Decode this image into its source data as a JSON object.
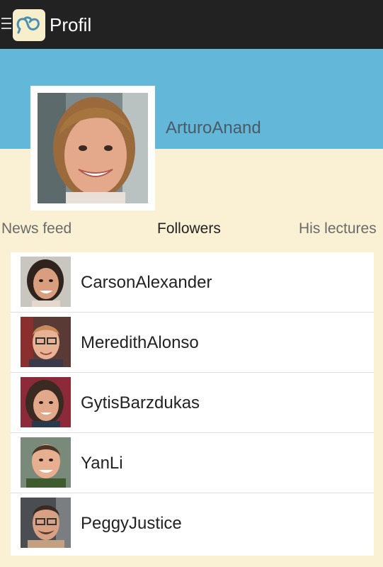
{
  "appbar": {
    "title": "Profil",
    "icons": [
      "menu-icon",
      "app-logo-icon"
    ]
  },
  "profile": {
    "username": "ArturoAnand"
  },
  "tabs": [
    {
      "label": "News feed",
      "active": false
    },
    {
      "label": "Followers",
      "active": true
    },
    {
      "label": "His lectures",
      "active": false
    }
  ],
  "followers": [
    {
      "name": "CarsonAlexander"
    },
    {
      "name": "MeredithAlonso"
    },
    {
      "name": "GytisBarzdukas"
    },
    {
      "name": "YanLi"
    },
    {
      "name": "PeggyJustice"
    }
  ],
  "colors": {
    "appbar": "#222222",
    "cover": "#63b8d9",
    "background": "#faf1d4"
  }
}
